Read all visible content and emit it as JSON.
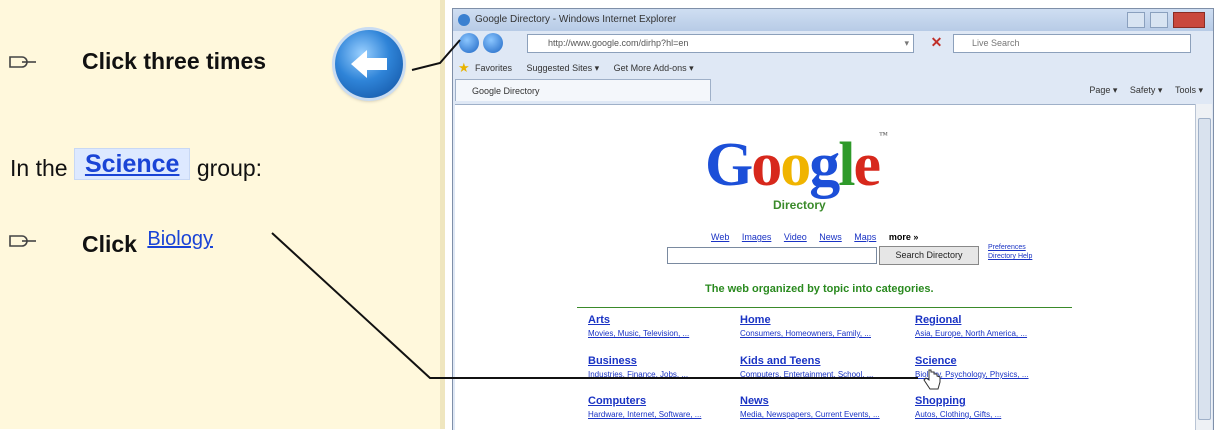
{
  "instructions": {
    "step1": "Click three times",
    "step2_prefix": "In the",
    "step2_group": "Science",
    "step2_suffix": "group:",
    "step3": "Click",
    "step3_link": "Biology"
  },
  "browser": {
    "title": "Google Directory - Windows Internet Explorer",
    "address": "http://www.google.com/dirhp?hl=en",
    "search_placeholder": "Live Search",
    "favorites": "Favorites",
    "suggested_sites": "Suggested Sites ▾",
    "get_more_addons": "Get More Add-ons ▾",
    "tab_label": "Google Directory",
    "tools": [
      "Page ▾",
      "Safety ▾",
      "Tools ▾"
    ]
  },
  "google": {
    "logo_letters": [
      "G",
      "o",
      "o",
      "g",
      "l",
      "e"
    ],
    "logo_colors": [
      "#1c4fd8",
      "#d7281c",
      "#f0b400",
      "#1c4fd8",
      "#2f9a2a",
      "#d7281c"
    ],
    "logo_sub": "Directory",
    "nav": [
      "Web",
      "Images",
      "Video",
      "News",
      "Maps"
    ],
    "nav_more": "more »",
    "search_button": "Search Directory",
    "pref_links": [
      "Preferences",
      "Directory Help"
    ],
    "tagline": "The web organized by topic into categories."
  },
  "categories": [
    {
      "title": "Arts",
      "sub": "Movies, Music, Television, ..."
    },
    {
      "title": "Home",
      "sub": "Consumers, Homeowners, Family, ..."
    },
    {
      "title": "Regional",
      "sub": "Asia, Europe, North America, ..."
    },
    {
      "title": "Business",
      "sub": "Industries, Finance, Jobs, ..."
    },
    {
      "title": "Kids and Teens",
      "sub": "Computers, Entertainment, School, ..."
    },
    {
      "title": "Science",
      "sub": "Biology, Psychology, Physics, ..."
    },
    {
      "title": "Computers",
      "sub": "Hardware, Internet, Software, ..."
    },
    {
      "title": "News",
      "sub": "Media, Newspapers, Current Events, ..."
    },
    {
      "title": "Shopping",
      "sub": "Autos, Clothing, Gifts, ..."
    }
  ]
}
